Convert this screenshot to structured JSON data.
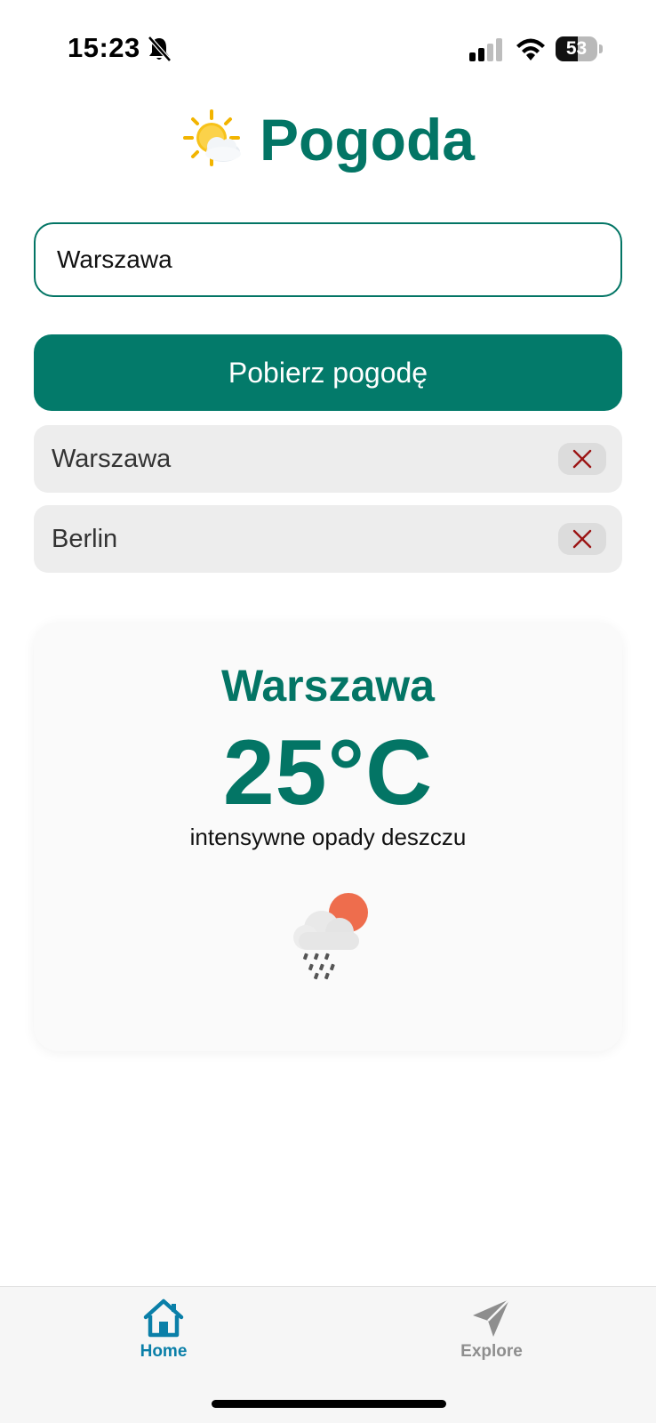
{
  "status_bar": {
    "time": "15:23",
    "battery_level": "53",
    "battery_fraction": 0.53,
    "icons": [
      "bell-off-icon",
      "cellular-signal-icon",
      "wifi-icon",
      "battery-icon"
    ]
  },
  "header": {
    "title": "Pogoda",
    "logo_icon": "sun-behind-cloud-icon"
  },
  "search": {
    "value": "Warszawa"
  },
  "fetch_button": {
    "label": "Pobierz pogodę"
  },
  "saved_cities": [
    {
      "name": "Warszawa",
      "remove_icon": "close-icon"
    },
    {
      "name": "Berlin",
      "remove_icon": "close-icon"
    }
  ],
  "weather": {
    "city": "Warszawa",
    "temperature": "25°C",
    "description": "intensywne opady deszczu",
    "icon": "rain-cloud-sun-icon"
  },
  "tab_bar": {
    "tabs": [
      {
        "label": "Home",
        "icon": "home-icon",
        "active": true
      },
      {
        "label": "Explore",
        "icon": "send-icon",
        "active": false
      }
    ]
  },
  "colors": {
    "primary": "#037565",
    "button": "#037a6a",
    "remove_icon": "#9b1414",
    "active_tab": "#0a7fa8",
    "inactive_tab": "#8e8e8e"
  }
}
